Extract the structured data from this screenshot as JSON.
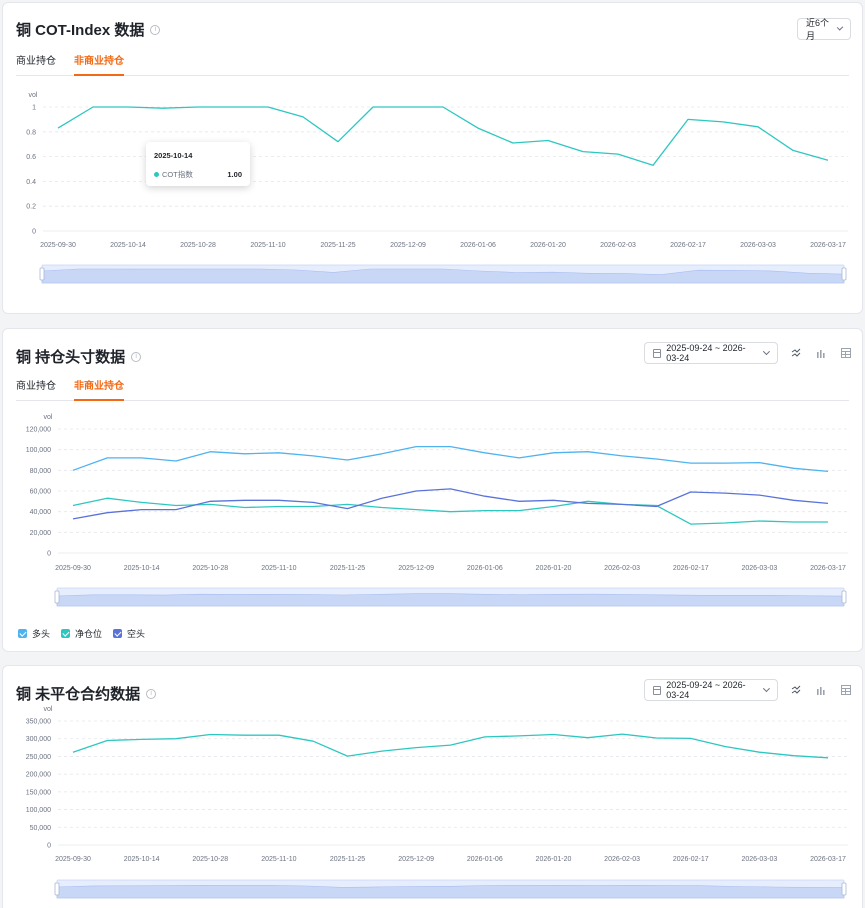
{
  "colors": {
    "teal": "#2ec7c0",
    "lightBlue": "#4fb3ef",
    "indigo": "#5a73db",
    "orange": "#f46a14"
  },
  "section1": {
    "title": "铜 COT-Index 数据",
    "range_select": "近6个月",
    "tabs": [
      "商业持仓",
      "非商业持仓"
    ],
    "active_tab": 1,
    "tooltip": {
      "date": "2025-10-14",
      "label": "COT指数",
      "value": "1.00"
    },
    "chart_data": {
      "type": "line",
      "ylabel": "vol",
      "ylim": [
        0,
        1
      ],
      "yticks": [
        "0",
        "0.2",
        "0.4",
        "0.6",
        "0.8",
        "1"
      ],
      "x_ticks": [
        "2025-09-30",
        "2025-10-14",
        "2025-10-28",
        "2025-11-10",
        "2025-11-25",
        "2025-12-09",
        "2026-01-06",
        "2026-01-20",
        "2026-02-03",
        "2026-02-17",
        "2026-03-03",
        "2026-03-17"
      ],
      "grid": true,
      "series": [
        {
          "color": "#2ec7c0",
          "values": [
            0.83,
            1.0,
            1.0,
            0.99,
            1.0,
            1.0,
            1.0,
            0.92,
            0.72,
            1.0,
            1.0,
            1.0,
            0.83,
            0.71,
            0.73,
            0.64,
            0.62,
            0.53,
            0.9,
            0.88,
            0.84,
            0.65,
            0.57
          ]
        }
      ]
    }
  },
  "section2": {
    "title": "铜 持仓头寸数据",
    "date_range": "2025-09-24 ~ 2026-03-24",
    "tabs": [
      "商业持仓",
      "非商业持仓"
    ],
    "active_tab": 1,
    "legend": [
      {
        "name": "多头",
        "color": "#4fb3ef"
      },
      {
        "name": "净仓位",
        "color": "#2ec7c0"
      },
      {
        "name": "空头",
        "color": "#5a73db"
      }
    ],
    "chart_data": {
      "type": "line",
      "ylabel": "vol",
      "ylim": [
        0,
        120000
      ],
      "yticks": [
        "0",
        "20,000",
        "40,000",
        "60,000",
        "80,000",
        "100,000",
        "120,000"
      ],
      "x_ticks": [
        "2025-09-30",
        "2025-10-14",
        "2025-10-28",
        "2025-11-10",
        "2025-11-25",
        "2025-12-09",
        "2026-01-06",
        "2026-01-20",
        "2026-02-03",
        "2026-02-17",
        "2026-03-03",
        "2026-03-17"
      ],
      "grid": true,
      "series": [
        {
          "name": "多头",
          "color": "#4fb3ef",
          "values": [
            80000,
            92000,
            92000,
            89000,
            98000,
            96000,
            97000,
            94000,
            90000,
            96000,
            103000,
            103000,
            97000,
            92000,
            97000,
            98000,
            94000,
            91000,
            87000,
            87000,
            87500,
            82000,
            79000
          ]
        },
        {
          "name": "净仓位",
          "color": "#2ec7c0",
          "values": [
            46000,
            53000,
            49000,
            46000,
            47000,
            44000,
            45000,
            45000,
            47000,
            44000,
            42000,
            40000,
            41000,
            41000,
            45000,
            50000,
            47000,
            46000,
            28000,
            29000,
            31000,
            30000,
            30000
          ]
        },
        {
          "name": "空头",
          "color": "#5a73db",
          "values": [
            33000,
            39000,
            42000,
            42000,
            50000,
            51000,
            51000,
            49000,
            43000,
            53000,
            60000,
            62000,
            55000,
            50000,
            51000,
            48000,
            47000,
            45000,
            59000,
            58000,
            56000,
            51000,
            48000
          ]
        }
      ]
    }
  },
  "section3": {
    "title": "铜 未平仓合约数据",
    "date_range": "2025-09-24 ~ 2026-03-24",
    "chart_data": {
      "type": "line",
      "ylabel": "vol",
      "ylim": [
        0,
        350000
      ],
      "yticks": [
        "0",
        "50,000",
        "100,000",
        "150,000",
        "200,000",
        "250,000",
        "300,000",
        "350,000"
      ],
      "x_ticks": [
        "2025-09-30",
        "2025-10-14",
        "2025-10-28",
        "2025-11-10",
        "2025-11-25",
        "2025-12-09",
        "2026-01-06",
        "2026-01-20",
        "2026-02-03",
        "2026-02-17",
        "2026-03-03",
        "2026-03-17"
      ],
      "grid": true,
      "series": [
        {
          "color": "#2ec7c0",
          "values": [
            262000,
            295000,
            298000,
            300000,
            312000,
            310000,
            310000,
            293000,
            251000,
            265000,
            275000,
            282000,
            305000,
            308000,
            312000,
            303000,
            313000,
            302000,
            301000,
            278000,
            262000,
            252000,
            246000
          ]
        }
      ]
    }
  }
}
